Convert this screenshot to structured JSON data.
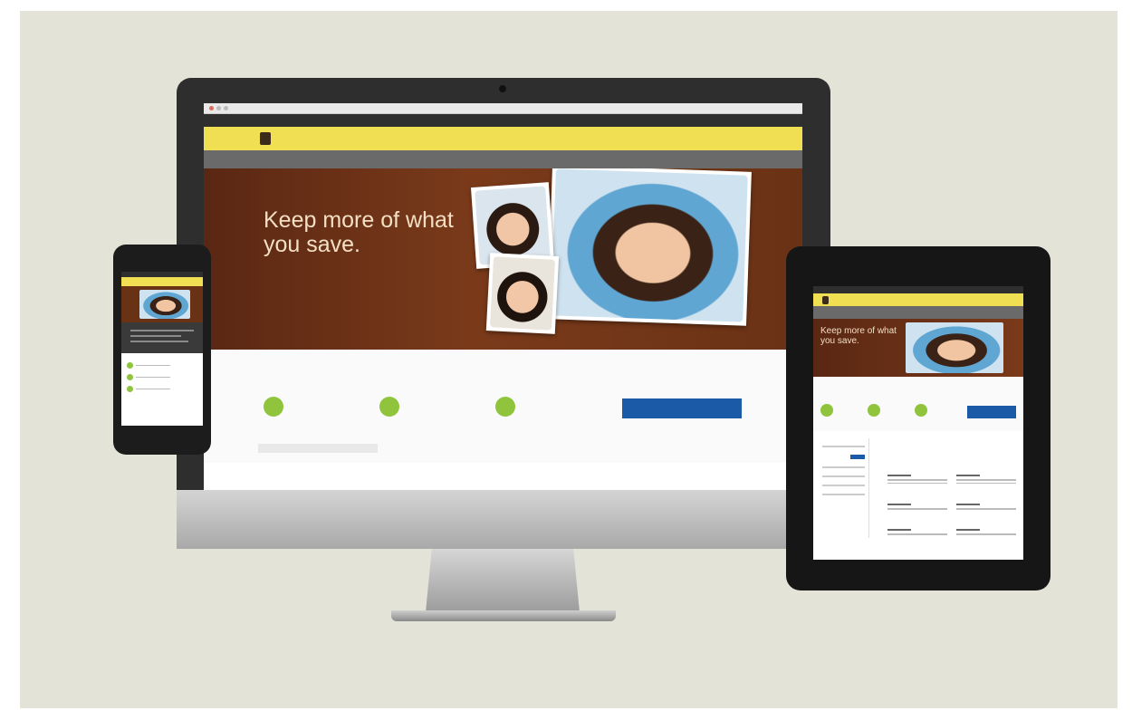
{
  "desktop": {
    "utility_links": [
      "",
      "",
      "",
      "",
      ""
    ],
    "logo_text": "",
    "brand_tagline": "",
    "nav_items": [
      "",
      "",
      "",
      ""
    ],
    "hero": {
      "headline": "Keep more of what you save.",
      "subtext": ""
    },
    "steps": {
      "title": "",
      "items": [
        "",
        "",
        ""
      ],
      "cta_label": ""
    },
    "login_placeholder": "",
    "section_title": ""
  },
  "tablet": {
    "hero_headline": "Keep more of what you save."
  },
  "colors": {
    "background": "#e3e3d8",
    "brand_yellow": "#f0df52",
    "nav_gray": "#6a6a6a",
    "hero_brown": "#6a3215",
    "accent_orange": "#e25b3a",
    "step_green": "#8fc43c",
    "cta_blue": "#1a5aa6"
  }
}
